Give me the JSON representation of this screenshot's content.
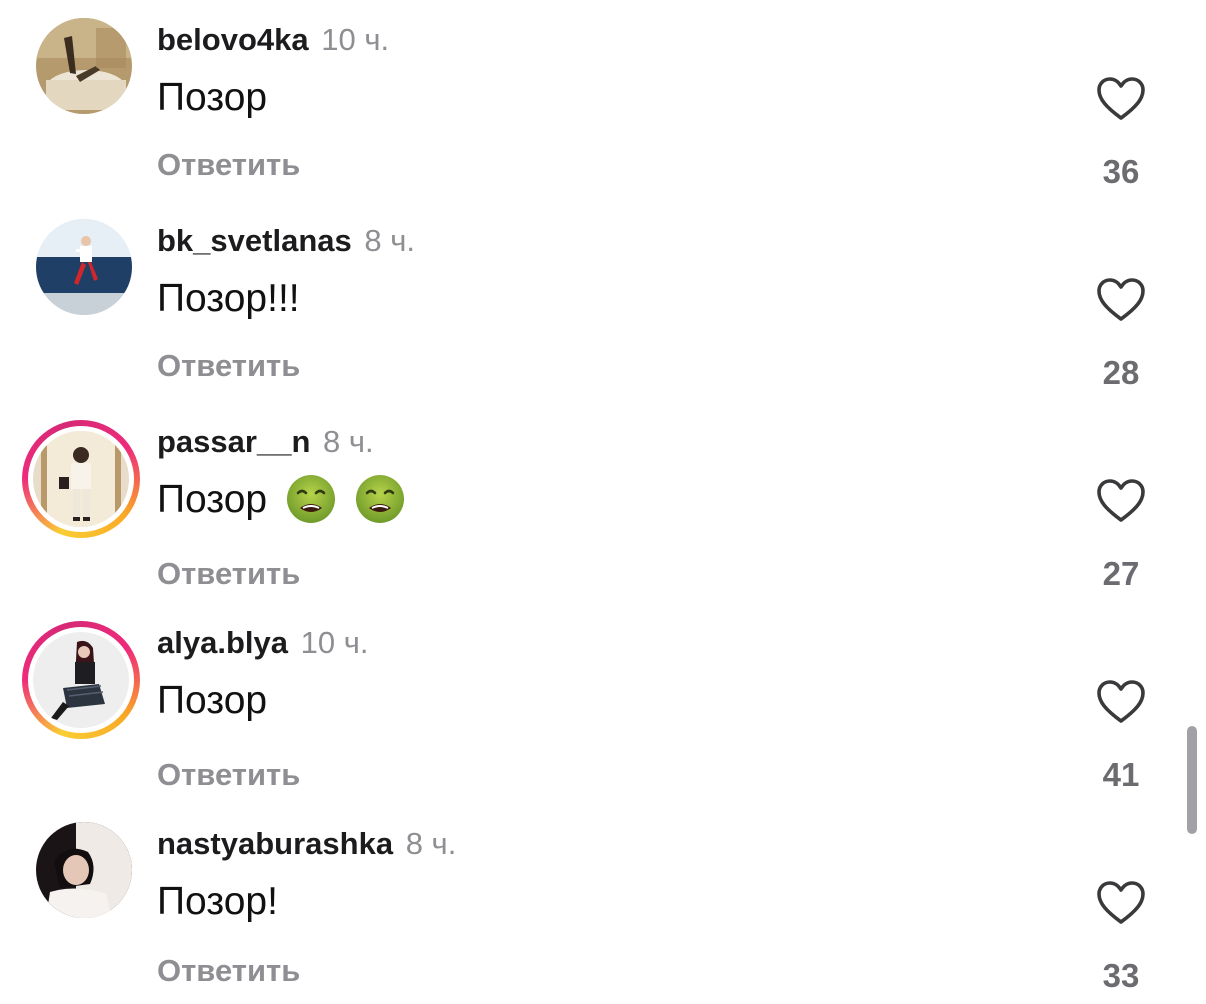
{
  "comments": [
    {
      "username": "belovo4ka",
      "time": "10 ч.",
      "text": "Позор",
      "emoji_count": 0,
      "reply_label": "Ответить",
      "likes": "36",
      "has_story": false,
      "avatar": "avatar-bathtub-photo"
    },
    {
      "username": "bk_svetlanas",
      "time": "8 ч.",
      "text": "Позор!!!",
      "emoji_count": 0,
      "reply_label": "Ответить",
      "likes": "28",
      "has_story": false,
      "avatar": "avatar-seaside-photo"
    },
    {
      "username": "passar__n",
      "time": "8 ч.",
      "text": "Позор",
      "emoji_count": 2,
      "emoji": "nauseated-face",
      "reply_label": "Ответить",
      "likes": "27",
      "has_story": true,
      "avatar": "avatar-mirror-photo"
    },
    {
      "username": "alya.blya",
      "time": "10 ч.",
      "text": "Позор",
      "emoji_count": 0,
      "reply_label": "Ответить",
      "likes": "41",
      "has_story": true,
      "avatar": "avatar-sitting-photo"
    },
    {
      "username": "nastyaburashka",
      "time": "8 ч.",
      "text": "Позор!",
      "emoji_count": 0,
      "reply_label": "Ответить",
      "likes": "33",
      "has_story": false,
      "avatar": "avatar-portrait-photo"
    }
  ],
  "colors": {
    "username": "#1c1c1e",
    "secondary_text": "#8e8e93",
    "like_count": "#6b6b70",
    "heart_stroke": "#3a3a3c",
    "story_ring_start": "#f9ce34",
    "story_ring_mid": "#ee2a7b"
  },
  "icons": {
    "like": "heart-outline-icon",
    "emoji": "nauseated-face"
  }
}
